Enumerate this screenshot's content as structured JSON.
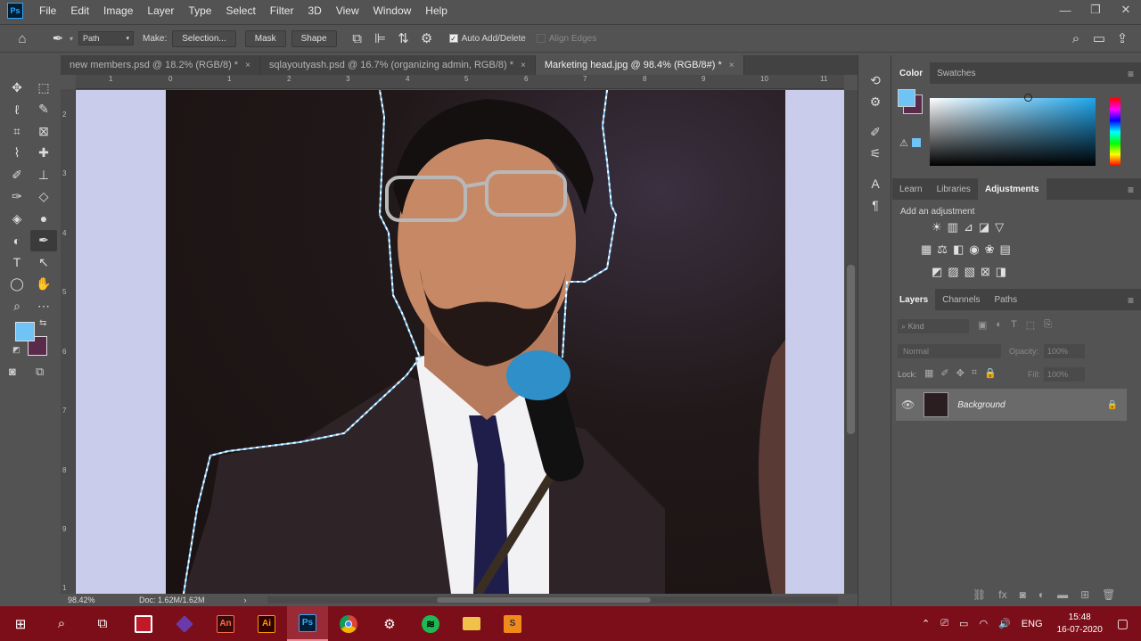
{
  "app": {
    "logo": "Ps",
    "menu": [
      "File",
      "Edit",
      "Image",
      "Layer",
      "Type",
      "Select",
      "Filter",
      "3D",
      "View",
      "Window",
      "Help"
    ]
  },
  "options": {
    "mode": "Path",
    "make_label": "Make:",
    "selection_btn": "Selection...",
    "mask_btn": "Mask",
    "shape_btn": "Shape",
    "auto_add_delete": "Auto Add/Delete",
    "align_edges": "Align Edges"
  },
  "tabs": [
    {
      "label": "new members.psd @ 18.2% (RGB/8) *",
      "close": "×"
    },
    {
      "label": "sqlayoutyash.psd @ 16.7% (organizing admin, RGB/8) *",
      "close": "×"
    },
    {
      "label": "Marketing head.jpg @ 98.4% (RGB/8#) *",
      "close": "×"
    }
  ],
  "ruler": {
    "top": [
      "1",
      "0",
      "1",
      "2",
      "3",
      "4",
      "5",
      "6",
      "7",
      "8",
      "9",
      "10",
      "11"
    ],
    "left": [
      "2",
      "3",
      "4",
      "5",
      "6",
      "7",
      "8",
      "9",
      "1"
    ]
  },
  "status": {
    "zoom": "98.42%",
    "doc": "Doc: 1.62M/1.62M"
  },
  "color_panel": {
    "tabs": [
      "Color",
      "Swatches"
    ],
    "fg": "#6fc3f5",
    "bg": "#5a2a4a"
  },
  "adjustments_panel": {
    "tabs": [
      "Learn",
      "Libraries",
      "Adjustments"
    ],
    "add_label": "Add an adjustment"
  },
  "layers_panel": {
    "tabs": [
      "Layers",
      "Channels",
      "Paths"
    ],
    "kind": "Kind",
    "blend": "Normal",
    "opacity_label": "Opacity:",
    "opacity_value": "100%",
    "lock_label": "Lock:",
    "fill_label": "Fill:",
    "fill_value": "100%",
    "layer_name": "Background"
  },
  "taskbar": {
    "lang": "ENG",
    "time": "15:48",
    "date": "16-07-2020"
  }
}
